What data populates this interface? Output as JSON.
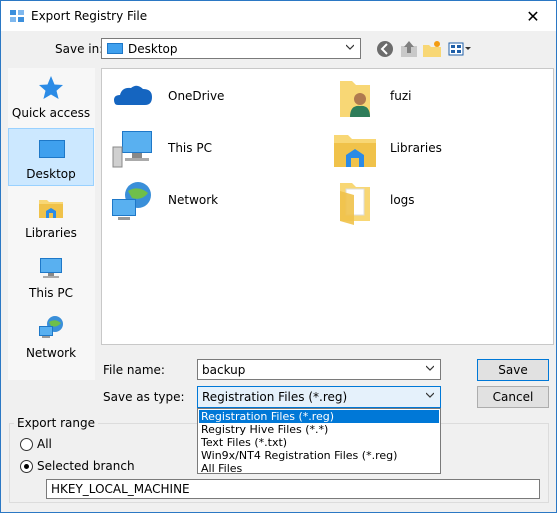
{
  "window": {
    "title": "Export Registry File",
    "close_glyph": "✕"
  },
  "toolbar": {
    "save_in_label": "Save in:",
    "save_in_value": "Desktop",
    "back_icon": "back-icon",
    "up_icon": "up-folder-icon",
    "new_folder_icon": "new-folder-icon",
    "view_menu_icon": "view-menu-icon"
  },
  "places": [
    {
      "label": "Quick access",
      "icon": "star-icon"
    },
    {
      "label": "Desktop",
      "icon": "desktop-icon",
      "selected": true
    },
    {
      "label": "Libraries",
      "icon": "libraries-icon"
    },
    {
      "label": "This PC",
      "icon": "this-pc-icon"
    },
    {
      "label": "Network",
      "icon": "network-icon"
    }
  ],
  "files": [
    {
      "label": "OneDrive",
      "icon": "onedrive-icon"
    },
    {
      "label": "fuzi",
      "icon": "user-folder-icon"
    },
    {
      "label": "This PC",
      "icon": "this-pc-icon"
    },
    {
      "label": "Libraries",
      "icon": "libraries-icon"
    },
    {
      "label": "Network",
      "icon": "network-icon"
    },
    {
      "label": "logs",
      "icon": "folder-icon"
    }
  ],
  "form": {
    "file_name_label": "File name:",
    "file_name_value": "backup",
    "save_as_type_label": "Save as type:",
    "save_as_type_value": "Registration Files (*.reg)",
    "save_button": "Save",
    "cancel_button": "Cancel"
  },
  "dropdown_options": [
    "Registration Files (*.reg)",
    "Registry Hive Files (*.*)",
    "Text Files (*.txt)",
    "Win9x/NT4 Registration Files (*.reg)",
    "All Files"
  ],
  "export_range": {
    "label": "Export range",
    "all_label": "All",
    "selected_label": "Selected branch",
    "branch_value": "HKEY_LOCAL_MACHINE",
    "selected_option": "Selected branch"
  },
  "colors": {
    "accent": "#0078d7",
    "selection": "#cce8ff",
    "folder": "#f8d775"
  }
}
